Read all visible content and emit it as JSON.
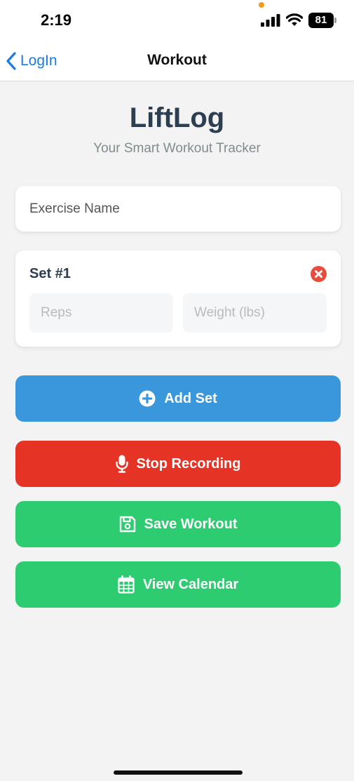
{
  "status_bar": {
    "time": "2:19",
    "battery": "81"
  },
  "nav": {
    "back_label": "LogIn",
    "title": "Workout"
  },
  "header": {
    "title": "LiftLog",
    "subtitle": "Your Smart Workout Tracker"
  },
  "exercise": {
    "placeholder": "Exercise Name",
    "value": ""
  },
  "sets": [
    {
      "label": "Set #1",
      "reps_placeholder": "Reps",
      "weight_placeholder": "Weight (lbs)"
    }
  ],
  "actions": {
    "add_set": "Add Set",
    "stop_recording": "Stop Recording",
    "save_workout": "Save Workout",
    "view_calendar": "View Calendar"
  },
  "colors": {
    "primary_text": "#2c3e50",
    "link_blue": "#1f7ae0",
    "add_blue": "#3a97dc",
    "stop_red": "#e53426",
    "save_green": "#2ecc71",
    "remove_red": "#e74c3c"
  },
  "icons": {
    "back": "chevron-left-icon",
    "remove_set": "close-circle-icon",
    "add_set": "plus-circle-icon",
    "stop_recording": "microphone-icon",
    "save_workout": "floppy-disk-icon",
    "view_calendar": "calendar-icon"
  }
}
